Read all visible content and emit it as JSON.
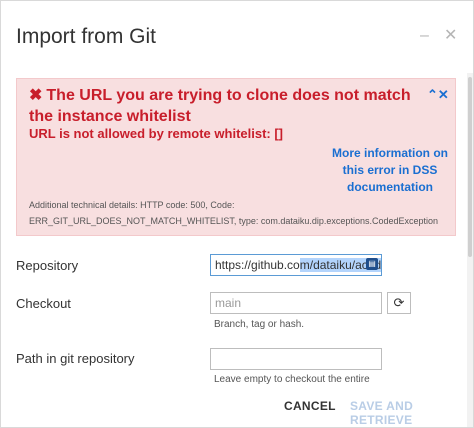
{
  "dialog": {
    "title": "Import from Git",
    "minimize_glyph": "–",
    "close_glyph": "✕"
  },
  "alert": {
    "icon": "✖",
    "title": "The URL you are trying to clone does not match the instance whitelist",
    "toggle_glyph": "⌃✕",
    "message": "URL is not allowed by remote whitelist: []",
    "link": "More information on this error in DSS documentation",
    "details": "Additional technical details: HTTP code: 500, Code: ERR_GIT_URL_DOES_NOT_MATCH_WHITELIST, type: com.dataiku.dip.exceptions.CodedException"
  },
  "form": {
    "repository": {
      "label": "Repository",
      "value_plain": "https://github.co",
      "value_selected": "m/dataiku/acade"
    },
    "checkout": {
      "label": "Checkout",
      "placeholder": "main",
      "help": "Branch, tag or hash.",
      "refresh_glyph": "⟳"
    },
    "path": {
      "label": "Path in git repository",
      "value": "",
      "help": "Leave empty to checkout the entire"
    }
  },
  "footer": {
    "cancel": "CANCEL",
    "save": "SAVE AND RETRIEVE"
  },
  "colors": {
    "error_text": "#c81e2b",
    "alert_bg": "#f8dfe0",
    "link": "#1a6fd1",
    "disabled_action": "#b9cde6"
  }
}
